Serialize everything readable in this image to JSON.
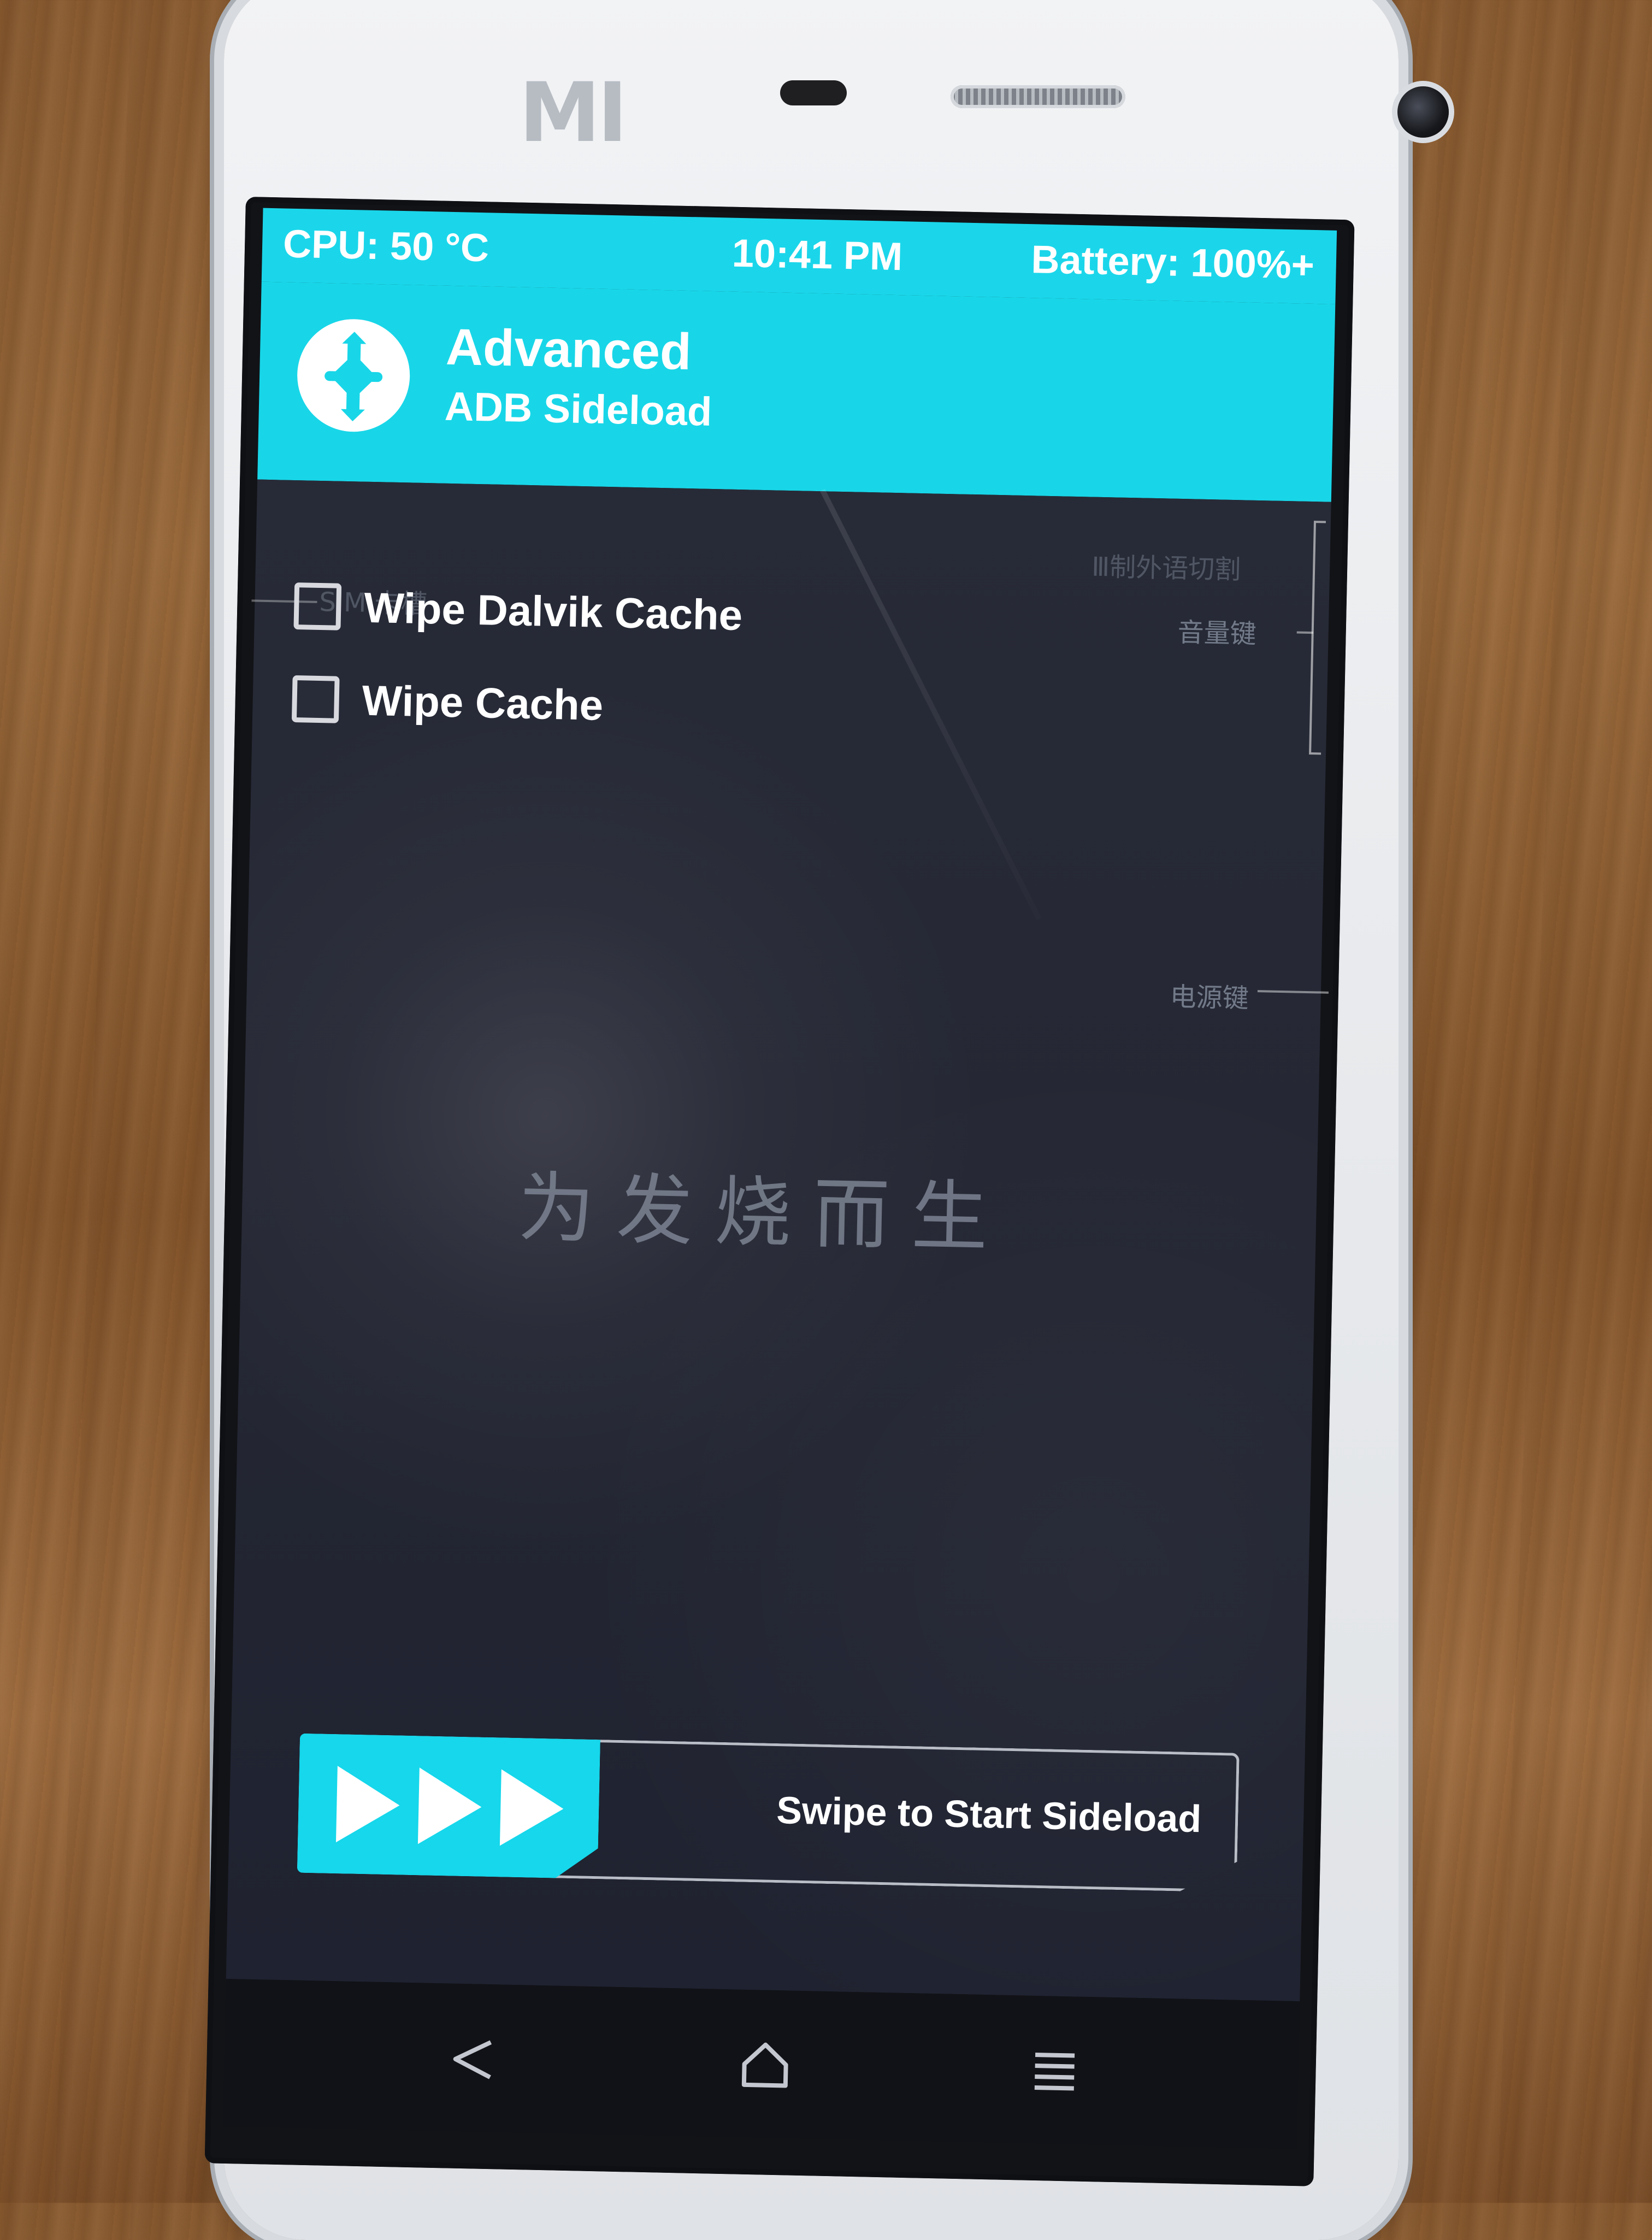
{
  "device": {
    "brand_logo": "MI"
  },
  "statusbar": {
    "cpu": "CPU: 50 °C",
    "time": "10:41 PM",
    "battery": "Battery: 100%+"
  },
  "header": {
    "title": "Advanced",
    "subtitle": "ADB Sideload",
    "logo_icon": "twrp-icon"
  },
  "options": [
    {
      "label": "Wipe Dalvik Cache",
      "checked": false
    },
    {
      "label": "Wipe Cache",
      "checked": false
    }
  ],
  "screen_overlay": {
    "center_text": "为发烧而生",
    "top_right_note": "Ⅲ制外语切割",
    "sim_note": "SIM 卡槽",
    "volume_note": "音量键",
    "power_note": "电源键"
  },
  "swipe": {
    "label": "Swipe to Start Sideload",
    "icon": "forward-arrows-icon"
  },
  "navbar": {
    "back_icon": "back-triangle-icon",
    "home_icon": "home-icon",
    "menu_icon": "menu-lines-icon"
  },
  "colors": {
    "accent": "#18D6E8",
    "screen_bg": "#252734",
    "text": "#FFFFFF",
    "muted": "#7C8392"
  }
}
